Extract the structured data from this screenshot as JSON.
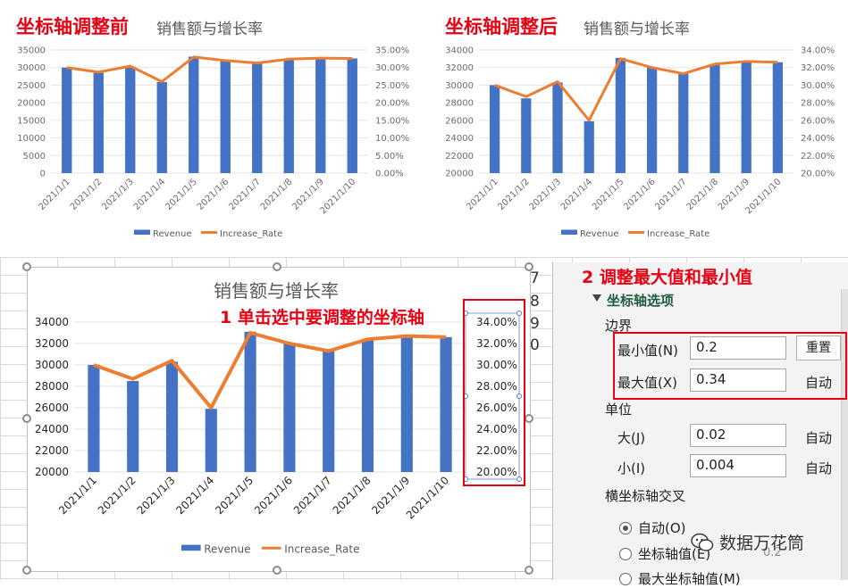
{
  "top_left": {
    "heading": "坐标轴调整前",
    "chart_title": "销售额与增长率"
  },
  "top_right": {
    "heading": "坐标轴调整后",
    "chart_title": "销售额与增长率"
  },
  "bottom_chart": {
    "chart_title": "销售额与增长率",
    "annotation": "1 单击选中要调整的坐标轴",
    "side_digits": [
      "7",
      "8",
      "9",
      "0"
    ]
  },
  "panel": {
    "annotation": "2 调整最大值和最小值",
    "section_title": "坐标轴选项",
    "bounds_label": "边界",
    "min_label": "最小值(N)",
    "min_value": "0.2",
    "reset_button": "重置",
    "max_label": "最大值(X)",
    "max_value": "0.34",
    "auto_label_1": "自动",
    "units_label": "单位",
    "major_label": "大(J)",
    "major_value": "0.02",
    "auto_label_2": "自动",
    "minor_label": "小(I)",
    "minor_value": "0.004",
    "auto_label_3": "自动",
    "cross_label": "横坐标轴交叉",
    "radio_auto": "自动(O)",
    "radio_axis_value": "坐标轴值(E)",
    "radio_max": "最大坐标轴值(M)",
    "partial_value": "0.2"
  },
  "watermark": "数据万花筒",
  "colors": {
    "bar": "#4472c4",
    "line": "#ed7d31",
    "red": "#e60012"
  },
  "chart_data": [
    {
      "type": "bar",
      "categories": [
        "2021/1/1",
        "2021/1/2",
        "2021/1/3",
        "2021/1/4",
        "2021/1/5",
        "2021/1/6",
        "2021/1/7",
        "2021/1/8",
        "2021/1/9",
        "2021/1/10"
      ],
      "series": [
        {
          "name": "Revenue",
          "type": "bar",
          "axis": "left",
          "values": [
            30000,
            28500,
            30300,
            25900,
            33100,
            32000,
            31300,
            32400,
            32700,
            32600
          ]
        },
        {
          "name": "Increase_Rate",
          "type": "line",
          "axis": "right",
          "values": [
            0.3,
            0.287,
            0.304,
            0.26,
            0.33,
            0.32,
            0.313,
            0.324,
            0.327,
            0.326
          ]
        }
      ],
      "title": "销售额与增长率",
      "ylim": [
        0,
        35000
      ],
      "yticks": [
        "35000",
        "30000",
        "25000",
        "20000",
        "15000",
        "10000",
        "5000",
        "0"
      ],
      "y2lim": [
        0,
        0.35
      ],
      "y2ticks": [
        "35.00%",
        "30.00%",
        "25.00%",
        "20.00%",
        "15.00%",
        "10.00%",
        "5.00%",
        "0.00%"
      ],
      "legend": "bottom"
    },
    {
      "type": "bar",
      "categories": [
        "2021/1/1",
        "2021/1/2",
        "2021/1/3",
        "2021/1/4",
        "2021/1/5",
        "2021/1/6",
        "2021/1/7",
        "2021/1/8",
        "2021/1/9",
        "2021/1/10"
      ],
      "series": [
        {
          "name": "Revenue",
          "type": "bar",
          "axis": "left",
          "values": [
            30000,
            28500,
            30300,
            25900,
            33100,
            32000,
            31300,
            32400,
            32700,
            32600
          ]
        },
        {
          "name": "Increase_Rate",
          "type": "line",
          "axis": "right",
          "values": [
            0.3,
            0.287,
            0.304,
            0.26,
            0.33,
            0.32,
            0.313,
            0.324,
            0.327,
            0.326
          ]
        }
      ],
      "title": "销售额与增长率",
      "ylim": [
        20000,
        34000
      ],
      "yticks": [
        "34000",
        "32000",
        "30000",
        "28000",
        "26000",
        "24000",
        "22000",
        "20000"
      ],
      "y2lim": [
        0.2,
        0.34
      ],
      "y2ticks": [
        "34.00%",
        "32.00%",
        "30.00%",
        "28.00%",
        "26.00%",
        "24.00%",
        "22.00%",
        "20.00%"
      ],
      "legend": "bottom"
    },
    {
      "type": "bar",
      "categories": [
        "2021/1/1",
        "2021/1/2",
        "2021/1/3",
        "2021/1/4",
        "2021/1/5",
        "2021/1/6",
        "2021/1/7",
        "2021/1/8",
        "2021/1/9",
        "2021/1/10"
      ],
      "series": [
        {
          "name": "Revenue",
          "type": "bar",
          "axis": "left",
          "values": [
            30000,
            28500,
            30300,
            25900,
            33100,
            32000,
            31300,
            32400,
            32700,
            32600
          ]
        },
        {
          "name": "Increase_Rate",
          "type": "line",
          "axis": "right",
          "values": [
            0.3,
            0.287,
            0.304,
            0.26,
            0.33,
            0.32,
            0.313,
            0.324,
            0.327,
            0.326
          ]
        }
      ],
      "title": "销售额与增长率",
      "ylim": [
        20000,
        34000
      ],
      "yticks": [
        "34000",
        "32000",
        "30000",
        "28000",
        "26000",
        "24000",
        "22000",
        "20000"
      ],
      "y2lim": [
        0.2,
        0.34
      ],
      "y2ticks": [
        "34.00%",
        "32.00%",
        "30.00%",
        "28.00%",
        "26.00%",
        "24.00%",
        "22.00%",
        "20.00%"
      ],
      "legend": "bottom"
    }
  ]
}
